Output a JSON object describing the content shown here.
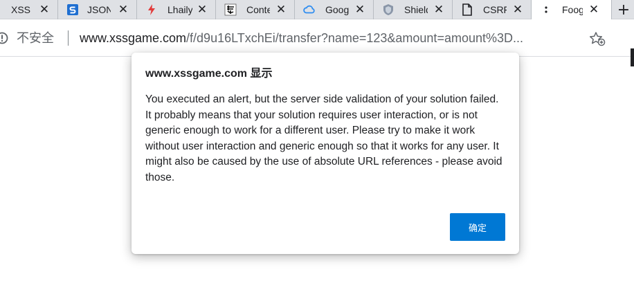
{
  "tabs": [
    {
      "label": "XSS Game",
      "icon": "xss-game-icon",
      "close": "✕"
    },
    {
      "label": "JSON",
      "icon": "json-s-icon",
      "close": "✕"
    },
    {
      "label": "Lhaily",
      "icon": "lightning-icon",
      "close": "✕"
    },
    {
      "label": "Content",
      "icon": "calligraphy-icon",
      "close": "✕"
    },
    {
      "label": "Google",
      "icon": "cloud-icon",
      "close": "✕"
    },
    {
      "label": "Shield",
      "icon": "shield-icon",
      "close": "✕"
    },
    {
      "label": "CSRF",
      "icon": "document-icon",
      "close": "✕"
    },
    {
      "label": "Foogle",
      "icon": "loading-dots-icon",
      "close": "✕",
      "active": true
    }
  ],
  "new_tab_label": "+",
  "address": {
    "security_label": "不安全",
    "url_host": "www.xssgame.com",
    "url_path": "/f/d9u16LTxchEi/transfer?name=123&amount=amount%3D..."
  },
  "dialog": {
    "title": "www.xssgame.com 显示",
    "message": "You executed an alert, but the server side validation of your solution failed. It probably means that your solution requires user interaction, or is not generic enough to work for a different user. Please try to make it work without user interaction and generic enough so that it works for any user. It might also be caused by the use of absolute URL references - please avoid those.",
    "ok_label": "确定"
  },
  "colors": {
    "tabbar_bg": "#dfe1e5",
    "ok_button": "#0078d4"
  }
}
